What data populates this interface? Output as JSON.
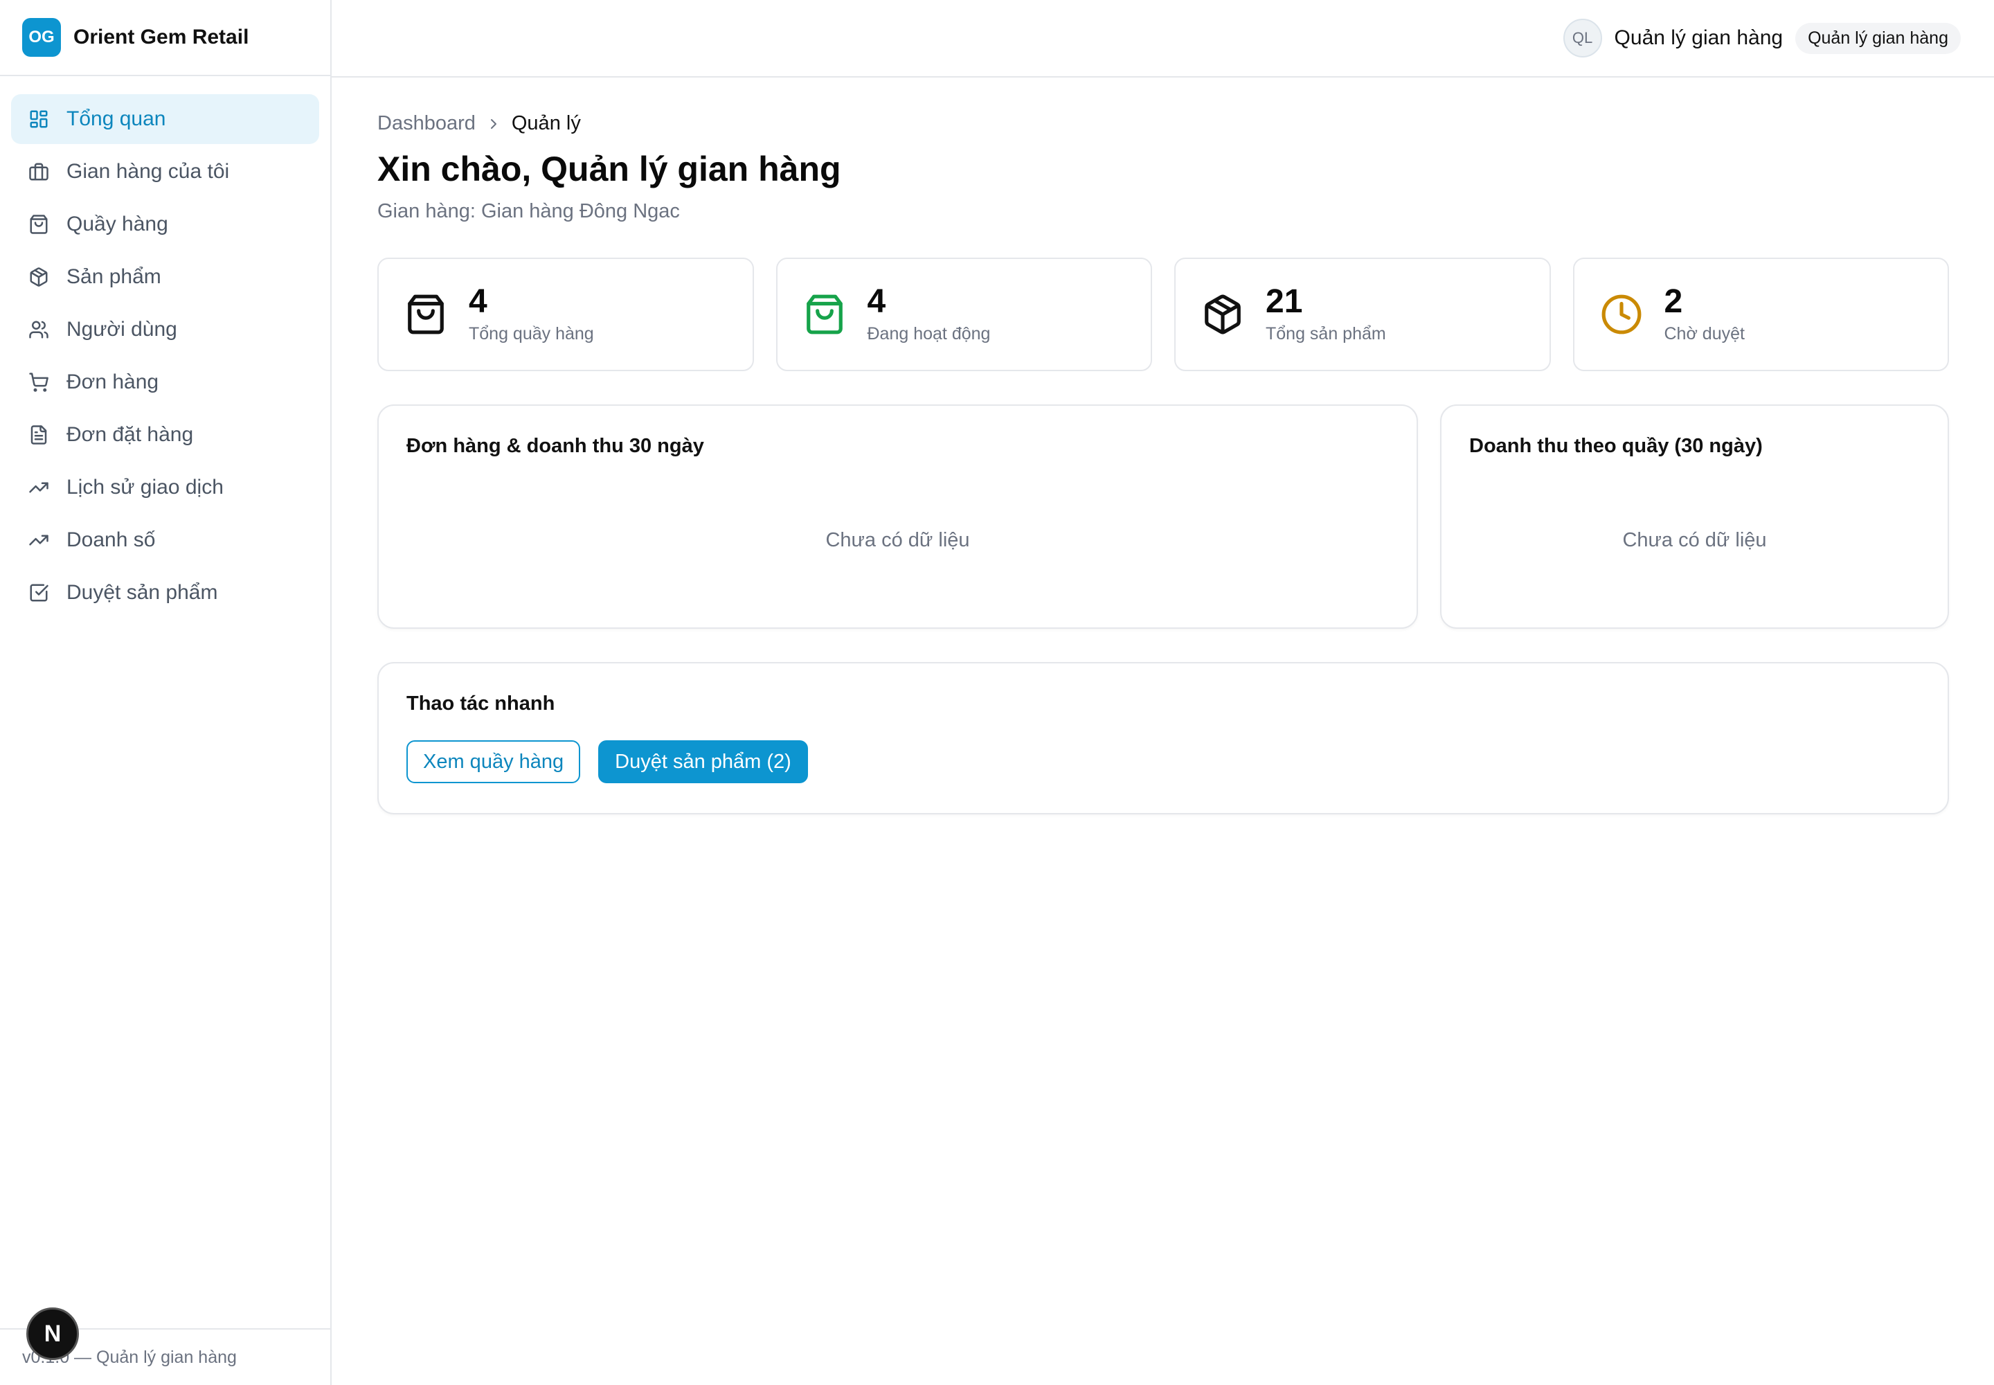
{
  "brand": {
    "logo_text": "OG",
    "name": "Orient Gem Retail",
    "accent": "#0d95d0"
  },
  "sidebar": {
    "items": [
      {
        "label": "Tổng quan",
        "icon": "dashboard-grid-icon",
        "active": true
      },
      {
        "label": "Gian hàng của tôi",
        "icon": "briefcase-icon"
      },
      {
        "label": "Quầy hàng",
        "icon": "shopping-bag-icon"
      },
      {
        "label": "Sản phẩm",
        "icon": "package-icon"
      },
      {
        "label": "Người dùng",
        "icon": "users-icon"
      },
      {
        "label": "Đơn hàng",
        "icon": "cart-icon"
      },
      {
        "label": "Đơn đặt hàng",
        "icon": "document-icon"
      },
      {
        "label": "Lịch sử giao dịch",
        "icon": "trending-up-icon"
      },
      {
        "label": "Doanh số",
        "icon": "trending-up-icon"
      },
      {
        "label": "Duyệt sản phẩm",
        "icon": "check-square-icon"
      }
    ],
    "footer": "v0.1.0 — Quản lý gian hàng"
  },
  "header": {
    "avatar_initials": "QL",
    "user_name": "Quản lý gian hàng",
    "role_badge": "Quản lý gian hàng"
  },
  "breadcrumb": {
    "root": "Dashboard",
    "current": "Quản lý"
  },
  "page": {
    "title": "Xin chào, Quản lý gian hàng",
    "subtitle": "Gian hàng: Gian hàng Đông Ngac"
  },
  "stats": [
    {
      "value": "4",
      "label": "Tổng quầy hàng",
      "icon": "shopping-bag-icon",
      "color": "#111111"
    },
    {
      "value": "4",
      "label": "Đang hoạt động",
      "icon": "shopping-bag-icon",
      "color": "#16a34a"
    },
    {
      "value": "21",
      "label": "Tổng sản phẩm",
      "icon": "package-icon",
      "color": "#111111"
    },
    {
      "value": "2",
      "label": "Chờ duyệt",
      "icon": "clock-icon",
      "color": "#ca8a04"
    }
  ],
  "charts": {
    "orders_revenue": {
      "title": "Đơn hàng & doanh thu 30 ngày",
      "empty": "Chưa có dữ liệu"
    },
    "revenue_by_counter": {
      "title": "Doanh thu theo quầy (30 ngày)",
      "empty": "Chưa có dữ liệu"
    }
  },
  "quick_actions": {
    "title": "Thao tác nhanh",
    "view_counters": "Xem quầy hàng",
    "approve_products": "Duyệt sản phẩm (2)"
  },
  "dev_badge": "N"
}
